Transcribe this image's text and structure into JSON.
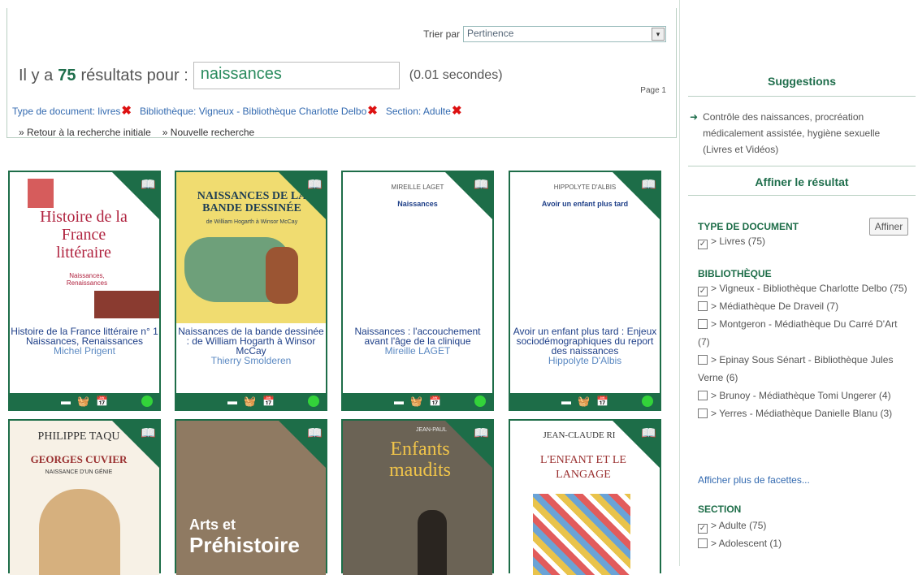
{
  "sort": {
    "label": "Trier par",
    "value": "Pertinence"
  },
  "results": {
    "prefix": "Il y a",
    "count": "75",
    "suffix": "résultats pour :",
    "query": "naissances",
    "timing": "(0.01 secondes)"
  },
  "page": "Page 1",
  "filters": [
    {
      "label": "Type de document: livres"
    },
    {
      "label": "Bibliothèque: Vigneux - Bibliothèque Charlotte Delbo"
    },
    {
      "label": "Section: Adulte"
    }
  ],
  "links": {
    "back": "» Retour à la recherche initiale",
    "new": "» Nouvelle recherche"
  },
  "books": [
    {
      "title": "Histoire de la France littéraire n° 1\nNaissances, Renaissances",
      "author": "Michel Prigent",
      "cover_text": "Histoire de la France littéraire",
      "cover_sub": "Naissances, Renaissances",
      "bg": "#ffffff"
    },
    {
      "title": "Naissances de la bande dessinée : de William Hogarth à Winsor McCay",
      "author": "Thierry Smolderen",
      "cover_text": "NAISSANCES DE LA BANDE DESSINÉE",
      "cover_sub": "de William Hogarth à Winsor McCay",
      "bg": "#f0dc70"
    },
    {
      "title": "Naissances : l'accouchement avant l'âge de la clinique",
      "author": "Mireille LAGET",
      "cover_text": "MIREILLE LAGET",
      "cover_sub": "Naissances",
      "bg": "#ffffff"
    },
    {
      "title": "Avoir un enfant plus tard : Enjeux sociodémographiques du report des naissances",
      "author": "Hippolyte D'Albis",
      "cover_text": "HIPPOLYTE D'ALBIS",
      "cover_sub": "Avoir un enfant plus tard",
      "bg": "#ffffff"
    },
    {
      "cover_text": "PHILIPPE TAQU",
      "cover_sub": "GEORGES CUVIER",
      "cover_sub2": "NAISSANCE D'UN GÉNIE",
      "bg": "#f7f1e6"
    },
    {
      "cover_text": "Arts et",
      "cover_sub": "Préhistoire",
      "bg": "#8f7a62"
    },
    {
      "cover_text": "Enfants maudits",
      "cover_sub": "JEAN-PAUL",
      "bg": "#6b6355"
    },
    {
      "cover_text": "JEAN-CLAUDE RI",
      "cover_sub": "L'ENFANT ET LE LANGAGE",
      "bg": "#ffffff"
    }
  ],
  "sidebar": {
    "suggestions_title": "Suggestions",
    "suggestion": "Contrôle des naissances, procréation médicalement assistée, hygiène sexuelle (Livres et Vidéos)",
    "refine_title": "Affiner le résultat",
    "affiner_btn": "Affiner",
    "type_head": "TYPE DE DOCUMENT",
    "type_items": [
      {
        "label": "> Livres",
        "count": "(75)",
        "checked": true
      }
    ],
    "lib_head": "BIBLIOTHÈQUE",
    "lib_items": [
      {
        "label": "> Vigneux - Bibliothèque Charlotte Delbo",
        "count": "(75)",
        "checked": true
      },
      {
        "label": "> Médiathèque De Draveil",
        "count": "(7)",
        "checked": false
      },
      {
        "label": "> Montgeron - Médiathèque Du Carré D'Art",
        "count": "(7)",
        "checked": false
      },
      {
        "label": "> Epinay Sous Sénart - Bibliothèque Jules Verne",
        "count": "(6)",
        "checked": false
      },
      {
        "label": "> Brunoy - Médiathèque Tomi Ungerer",
        "count": "(4)",
        "checked": false
      },
      {
        "label": "> Yerres - Médiathèque Danielle Blanu",
        "count": "(3)",
        "checked": false
      }
    ],
    "more": "Afficher plus de facettes...",
    "section_head": "SECTION",
    "section_items": [
      {
        "label": "> Adulte",
        "count": "(75)",
        "checked": true
      },
      {
        "label": "> Adolescent",
        "count": "(1)",
        "checked": false
      }
    ]
  }
}
